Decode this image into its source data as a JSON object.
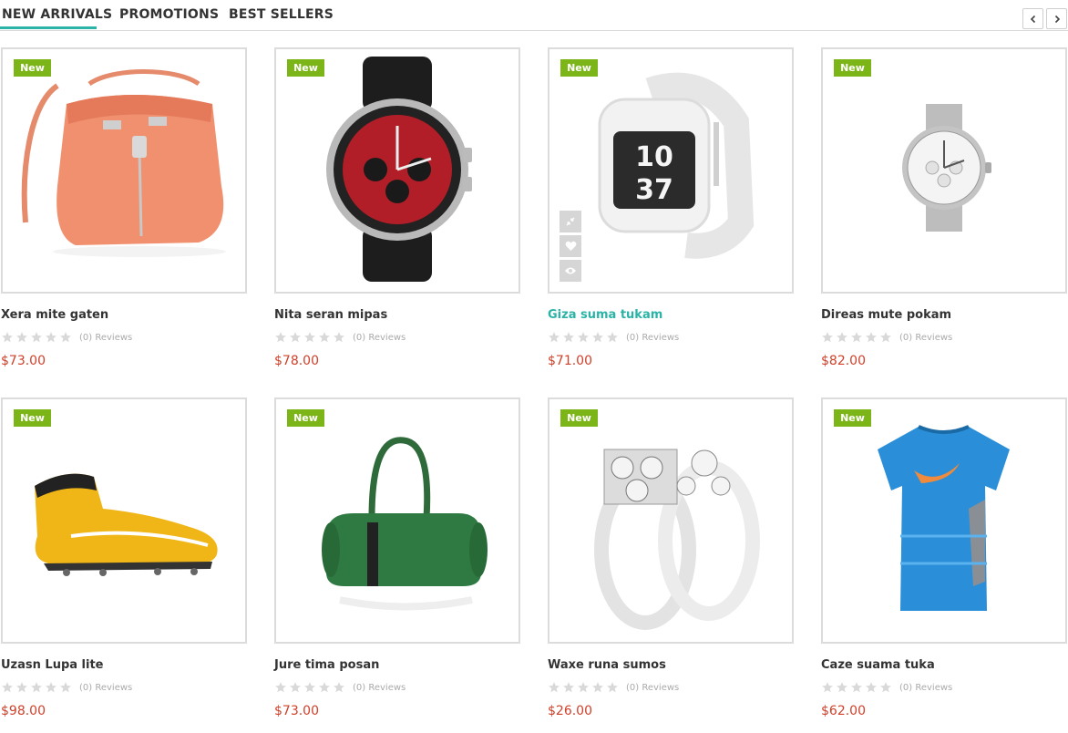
{
  "tabs": [
    {
      "label": "NEW ARRIVALS",
      "active": true
    },
    {
      "label": "PROMOTIONS",
      "active": false
    },
    {
      "label": "BEST SELLERS",
      "active": false
    }
  ],
  "nav": {
    "prev_icon": "chevron-left-icon",
    "next_icon": "chevron-right-icon"
  },
  "colors": {
    "accent": "#2ab3a6",
    "badge": "#7bb517",
    "price": "#d0402a"
  },
  "products": [
    {
      "badge": "New",
      "name": "Xera mite gaten",
      "reviews": "(0) Reviews",
      "price": "$73.00",
      "rating": 0,
      "image": "orange-bucket-bag"
    },
    {
      "badge": "New",
      "name": "Nita seran mipas",
      "reviews": "(0) Reviews",
      "price": "$78.00",
      "rating": 0,
      "image": "red-chronograph-watch"
    },
    {
      "badge": "New",
      "name": "Giza suma tukam",
      "reviews": "(0) Reviews",
      "price": "$71.00",
      "rating": 0,
      "image": "white-sport-watch",
      "hovered": true
    },
    {
      "badge": "New",
      "name": "Direas mute pokam",
      "reviews": "(0) Reviews",
      "price": "$82.00",
      "rating": 0,
      "image": "silver-chronograph-watch"
    },
    {
      "badge": "New",
      "name": "Uzasn Lupa lite",
      "reviews": "(0) Reviews",
      "price": "$98.00",
      "rating": 0,
      "image": "yellow-football-boot"
    },
    {
      "badge": "New",
      "name": "Jure tima posan",
      "reviews": "(0) Reviews",
      "price": "$73.00",
      "rating": 0,
      "image": "green-duffle-bag"
    },
    {
      "badge": "New",
      "name": "Waxe runa sumos",
      "reviews": "(0) Reviews",
      "price": "$26.00",
      "rating": 0,
      "image": "diamond-rings"
    },
    {
      "badge": "New",
      "name": "Caze suama tuka",
      "reviews": "(0) Reviews",
      "price": "$62.00",
      "rating": 0,
      "image": "blue-sport-shirt"
    }
  ],
  "hover_actions": [
    "compare-icon",
    "heart-icon",
    "eye-icon"
  ]
}
